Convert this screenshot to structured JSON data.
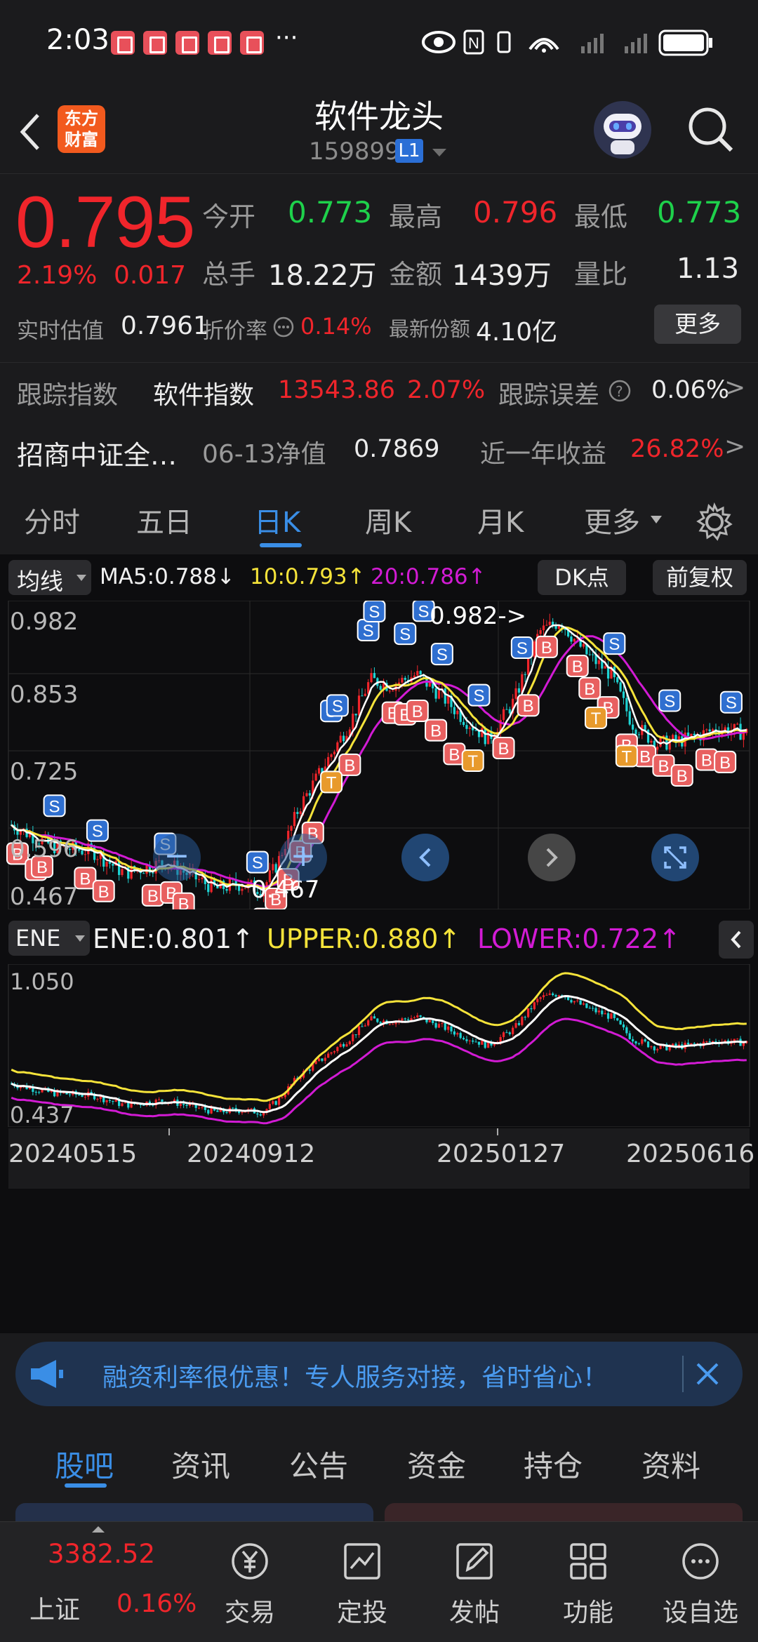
{
  "status": {
    "time": "2:03",
    "more": "···"
  },
  "header": {
    "title": "软件龙头",
    "code": "159899",
    "level": "L1",
    "logo_line1": "东方",
    "logo_line2": "财富"
  },
  "quote": {
    "price": "0.795",
    "change_pct": "2.19%",
    "change_abs": "0.017",
    "open_label": "今开",
    "open": "0.773",
    "high_label": "最高",
    "high": "0.796",
    "low_label": "最低",
    "low": "0.773",
    "volume_label": "总手",
    "volume": "18.22万",
    "amount_label": "金额",
    "amount": "1439万",
    "ratio_label": "量比",
    "ratio": "1.13",
    "iopv_label": "实时估值",
    "iopv": "0.7961",
    "discount_label": "折价率",
    "discount": "0.14%",
    "shares_label": "最新份额",
    "shares": "4.10亿",
    "more_button": "更多"
  },
  "tracking": {
    "index_label": "跟踪指数",
    "index_name": "软件指数",
    "index_value": "13543.86",
    "index_change": "2.07%",
    "error_label": "跟踪误差",
    "error_value": "0.06%",
    "fund_name": "招商中证全…",
    "nav_label": "06-13净值",
    "nav_value": "0.7869",
    "yield_label": "近一年收益",
    "yield_value": "26.82%"
  },
  "ktabs": [
    "分时",
    "五日",
    "日K",
    "周K",
    "月K",
    "更多"
  ],
  "ktab_active": "日K",
  "ma_bar": {
    "selector": "均线",
    "ma5": "MA5:0.788↓",
    "ma10": "10:0.793↑",
    "ma20": "20:0.786↑",
    "dk_button": "DK点",
    "adjust_button": "前复权"
  },
  "main_chart": {
    "y_labels": [
      "0.982",
      "0.853",
      "0.725",
      "0.596",
      "0.467"
    ],
    "max_annotation": "0.982->",
    "min_annotation": "0.467"
  },
  "ene_bar": {
    "selector": "ENE",
    "ene": "ENE:0.801↑",
    "upper": "UPPER:0.880↑",
    "lower": "LOWER:0.722↑"
  },
  "ene_chart": {
    "y_top": "1.050",
    "y_bottom": "0.437"
  },
  "x_labels": [
    "20240515",
    "20240912",
    "20250127",
    "20250616"
  ],
  "banner": {
    "text": "融资利率很优惠！专人服务对接，省时省心！"
  },
  "bottom_tabs": [
    "股吧",
    "资讯",
    "公告",
    "资金",
    "持仓",
    "资料"
  ],
  "bottom_tab_active": "股吧",
  "nav": {
    "index_value": "3382.52",
    "index_name": "上证",
    "index_change": "0.16%",
    "items": [
      "交易",
      "定投",
      "发帖",
      "功能",
      "设自选"
    ]
  },
  "colors": {
    "up": "#f0252b",
    "down": "#1ed14b",
    "accent": "#3a8ee6",
    "ma5": "#ffffff",
    "ma10": "#f5e33a",
    "ma20": "#d21bd4"
  }
}
